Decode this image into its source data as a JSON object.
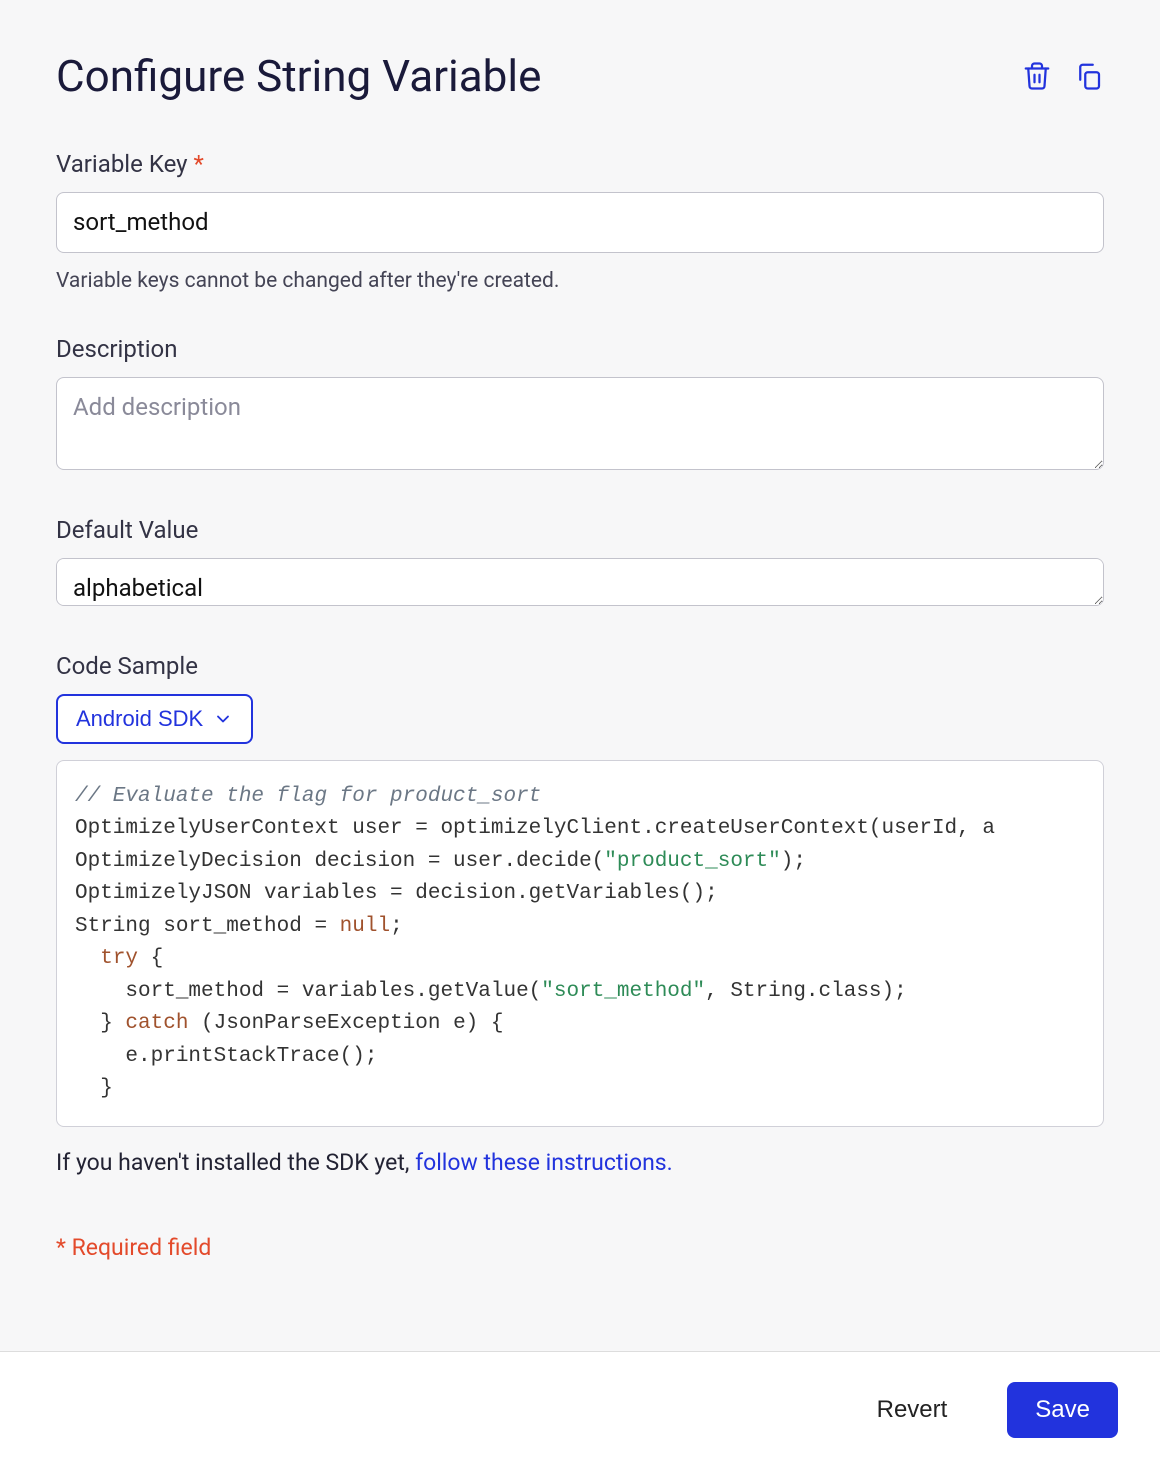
{
  "header": {
    "title": "Configure String Variable"
  },
  "fields": {
    "variable_key": {
      "label": "Variable Key",
      "required_mark": "*",
      "value": "sort_method",
      "helper": "Variable keys cannot be changed after they're created."
    },
    "description": {
      "label": "Description",
      "placeholder": "Add description",
      "value": ""
    },
    "default_value": {
      "label": "Default Value",
      "value": "alphabetical"
    }
  },
  "code_sample": {
    "label": "Code Sample",
    "sdk_selected": "Android SDK",
    "lines": {
      "l1_comment": "// Evaluate the flag for product_sort",
      "l2a": "OptimizelyUserContext user = optimizelyClient.createUserContext(userId, a",
      "l3a": "OptimizelyDecision decision = user.decide(",
      "l3_str": "\"product_sort\"",
      "l3b": ");",
      "l4": "OptimizelyJSON variables = decision.getVariables();",
      "l5a": "String sort_method = ",
      "l5_kw": "null",
      "l5b": ";",
      "l6_try": "try",
      "l6b": " {",
      "l7a": "    sort_method = variables.getValue(",
      "l7_str": "\"sort_method\"",
      "l7b": ", String.class);",
      "l8a": "  } ",
      "l8_catch": "catch",
      "l8b": " (JsonParseException e) {",
      "l9": "    e.printStackTrace();",
      "l10": "  }"
    },
    "note_prefix": "If you haven't installed the SDK yet, ",
    "note_link": "follow these instructions."
  },
  "required_note": "* Required field",
  "footer": {
    "revert": "Revert",
    "save": "Save"
  }
}
